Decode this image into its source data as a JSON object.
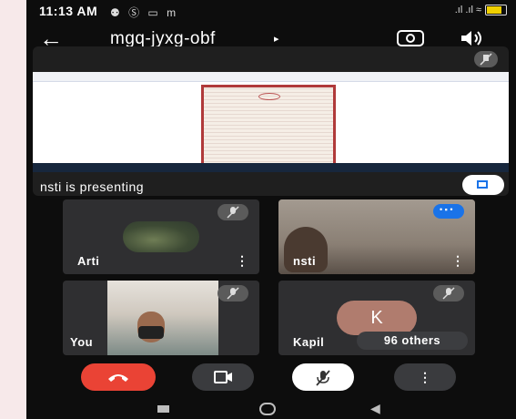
{
  "status_bar": {
    "time": "11:13 AM",
    "notification_icons": "⚉ Ⓢ ▭ m",
    "signal_text": ".ıl .ıl ≈"
  },
  "top_bar": {
    "meeting_code": "mgq-jyxg-obf",
    "chevron": "▸",
    "back_icon": "arrow-left-icon",
    "switch_camera_icon": "switch-camera-icon",
    "speaker_icon": "speaker-icon"
  },
  "presentation": {
    "presenter_text": "nsti is presenting"
  },
  "participants": {
    "arti": {
      "name": "Arti",
      "menu": "⋮"
    },
    "nsti": {
      "name": "nsti",
      "menu": "⋮"
    },
    "you": {
      "name": "You"
    },
    "kapil": {
      "name": "Kapil",
      "initial": "K",
      "others": "96 others"
    }
  },
  "controls": {
    "more": "⋮"
  },
  "colors": {
    "end_call": "#ea4335",
    "accent_blue": "#1a73e8",
    "tile_bg": "#2f2f31",
    "kapil_avatar": "#b07c6e"
  }
}
